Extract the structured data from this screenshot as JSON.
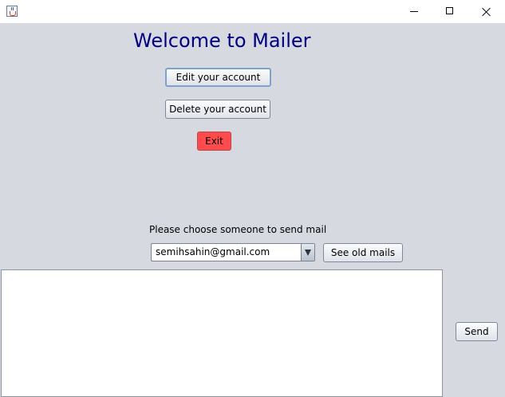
{
  "window": {
    "icon": "java-app-icon",
    "controls": {
      "minimize": "minimize-icon",
      "maximize": "maximize-icon",
      "close": "close-icon"
    }
  },
  "main": {
    "welcome_title": "Welcome to Mailer",
    "edit_account_label": "Edit your account",
    "delete_account_label": "Delete your account",
    "exit_label": "Exit",
    "choose_label": "Please choose someone to send mail",
    "recipient_selected": "semihsahin@gmail.com",
    "see_old_mails_label": "See old mails",
    "mail_body": "",
    "send_label": "Send"
  },
  "colors": {
    "background": "#d6d9df",
    "title_text": "#000080",
    "exit_button": "#ff4b4b",
    "focus_border": "#7da2ce"
  }
}
